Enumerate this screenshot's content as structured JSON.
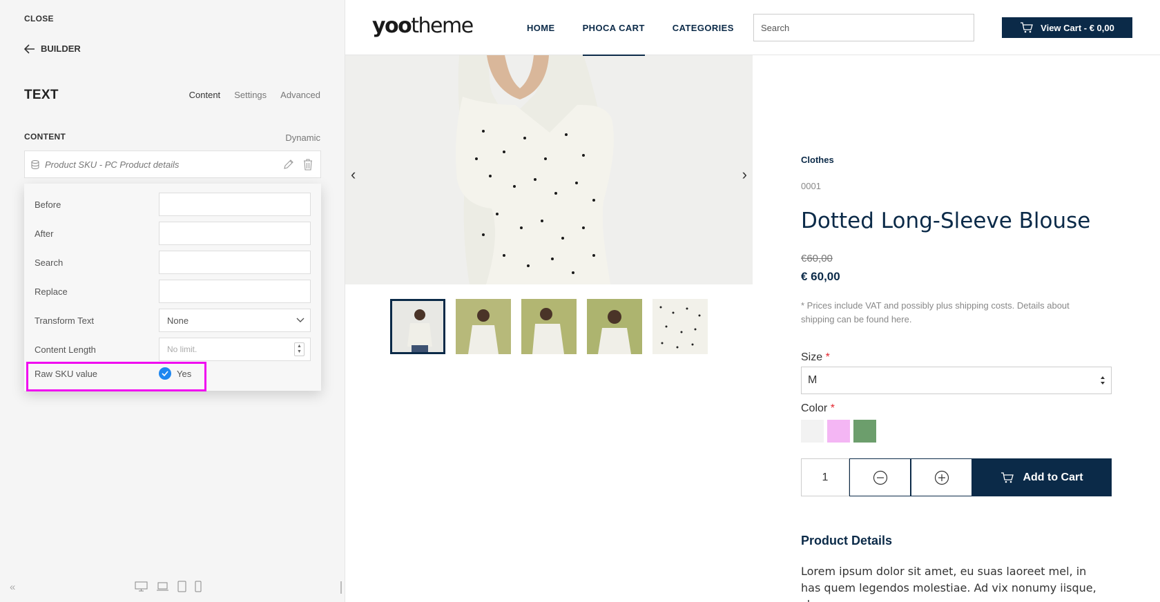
{
  "sidebar": {
    "close_label": "CLOSE",
    "builder_label": "BUILDER",
    "panel_title": "TEXT",
    "tabs": [
      {
        "label": "Content",
        "active": true
      },
      {
        "label": "Settings",
        "active": false
      },
      {
        "label": "Advanced",
        "active": false
      }
    ],
    "content_section_label": "CONTENT",
    "dynamic_label": "Dynamic",
    "source_value": "Product SKU - PC Product details",
    "fields": {
      "before_label": "Before",
      "after_label": "After",
      "search_label": "Search",
      "replace_label": "Replace",
      "transform_label": "Transform Text",
      "transform_value": "None",
      "content_length_label": "Content Length",
      "content_length_placeholder": "No limit.",
      "raw_sku_label": "Raw SKU value",
      "raw_sku_value": "Yes"
    },
    "footer_chevrons": "«"
  },
  "site": {
    "logo_bold": "yoo",
    "logo_rest": "theme",
    "nav": [
      {
        "label": "HOME",
        "active": false
      },
      {
        "label": "PHOCA CART",
        "active": true
      },
      {
        "label": "CATEGORIES",
        "active": false
      }
    ],
    "search_placeholder": "Search",
    "cart_label": "View Cart - € 0,00"
  },
  "product": {
    "category": "Clothes",
    "sku": "0001",
    "title": "Dotted Long-Sleeve Blouse",
    "old_price": "€60,00",
    "price": "€ 60,00",
    "vat_note": "* Prices include VAT and possibly plus shipping costs. Details about shipping can be found here.",
    "size_label": "Size",
    "size_value": "M",
    "color_label": "Color",
    "required_mark": "*",
    "colors": [
      "#f2f2f2",
      "#f4b6f4",
      "#6c9e6c"
    ],
    "quantity": "1",
    "add_to_cart_label": "Add to Cart",
    "details_title": "Product Details",
    "details_text": "Lorem ipsum dolor sit amet, eu suas laoreet mel, in has quem legendos molestiae. Ad vix nonumy iisque, choro"
  },
  "colors": {
    "brand": "#0b2a48",
    "accent": "#1e87f0",
    "highlight": "#f007f0"
  }
}
